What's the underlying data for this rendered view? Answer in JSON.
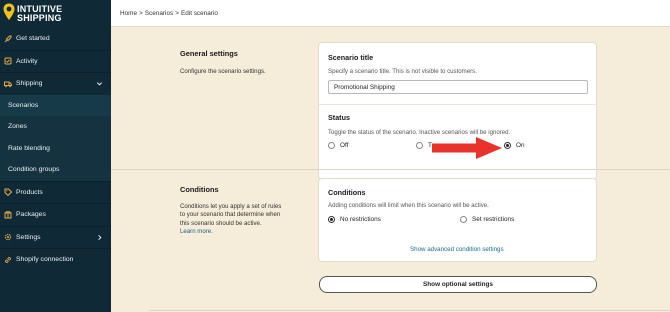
{
  "brand": {
    "line1": "INTUITIVE",
    "line2": "SHIPPING"
  },
  "sidebar": {
    "items": [
      {
        "label": "Get started"
      },
      {
        "label": "Activity"
      },
      {
        "label": "Shipping"
      },
      {
        "label": "Scenarios"
      },
      {
        "label": "Zones"
      },
      {
        "label": "Rate blending"
      },
      {
        "label": "Condition groups"
      },
      {
        "label": "Products"
      },
      {
        "label": "Packages"
      },
      {
        "label": "Settings"
      },
      {
        "label": "Shopify connection"
      }
    ]
  },
  "breadcrumb": {
    "home": "Home",
    "sep1": ">",
    "scenarios": "Scenarios",
    "sep2": ">",
    "current": "Edit scenario"
  },
  "general": {
    "title": "General settings",
    "desc": "Configure the scenario settings.",
    "scenario_title_label": "Scenario title",
    "scenario_title_help": "Specify a scenario title. This is not visible to customers.",
    "scenario_title_value": "Promotional Shipping",
    "status_label": "Status",
    "status_help": "Toggle the status of the scenario. Inactive scenarios will be ignored.",
    "status_options": [
      "Off",
      "T",
      "On"
    ],
    "status_selected": "On"
  },
  "conditions": {
    "title": "Conditions",
    "desc_lines": [
      "Conditions let you apply a set of rules",
      "to your scenario that determine when",
      "this scenario should be active."
    ],
    "learn_more": "Learn more.",
    "card_title": "Conditions",
    "card_help": "Adding conditions will limit when this scenario will be active.",
    "options": [
      "No restrictions",
      "Set restrictions"
    ],
    "selected": "No restrictions",
    "advanced_link": "Show advanced condition settings"
  },
  "optional_button": "Show optional settings",
  "colors": {
    "sidebar": "#0f2a36",
    "background": "#f5ecd9",
    "arrow": "#e8322a",
    "link": "#1a6e8c"
  }
}
